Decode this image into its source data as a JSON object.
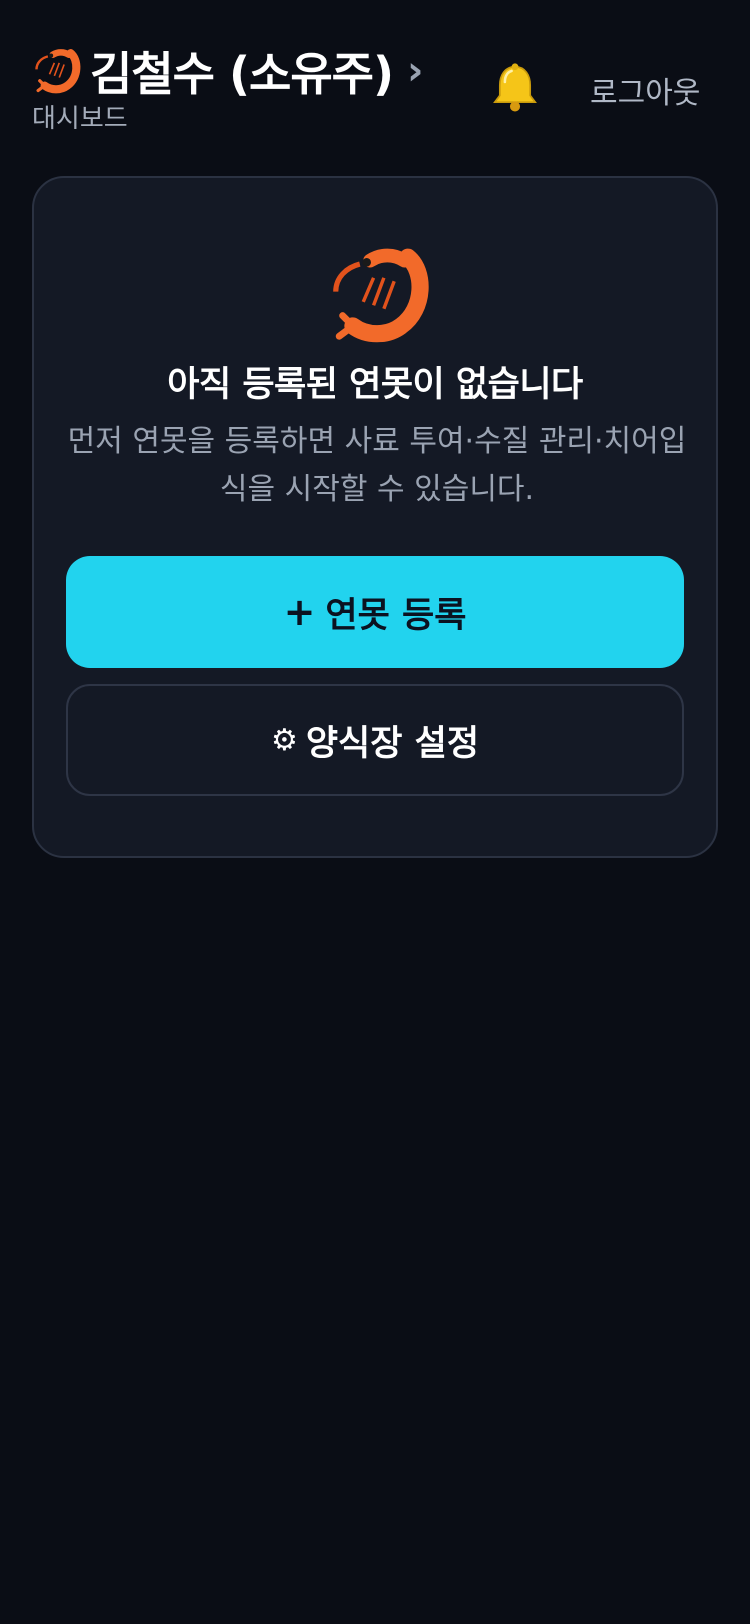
{
  "header": {
    "brand_icon": "shrimp-icon",
    "owner_name": "김철수 (소유주)",
    "chevron": "›",
    "subtitle": "대시보드",
    "notification_icon": "bell-icon",
    "logout_label": "로그아웃"
  },
  "empty_state": {
    "icon": "shrimp-icon",
    "title": "아직 등록된 연못이 없습니다",
    "description": "먼저 연못을 등록하면 사료 투여·수질 관리·치어입식을 시작할 수 있습니다.",
    "primary_button": {
      "icon": "+",
      "label": "연못 등록"
    },
    "secondary_button": {
      "icon": "⚙",
      "label": "양식장 설정"
    }
  },
  "colors": {
    "background": "#0a0d15",
    "card": "#141925",
    "accent": "#22d3ee",
    "muted_text": "#9aa3b2"
  }
}
